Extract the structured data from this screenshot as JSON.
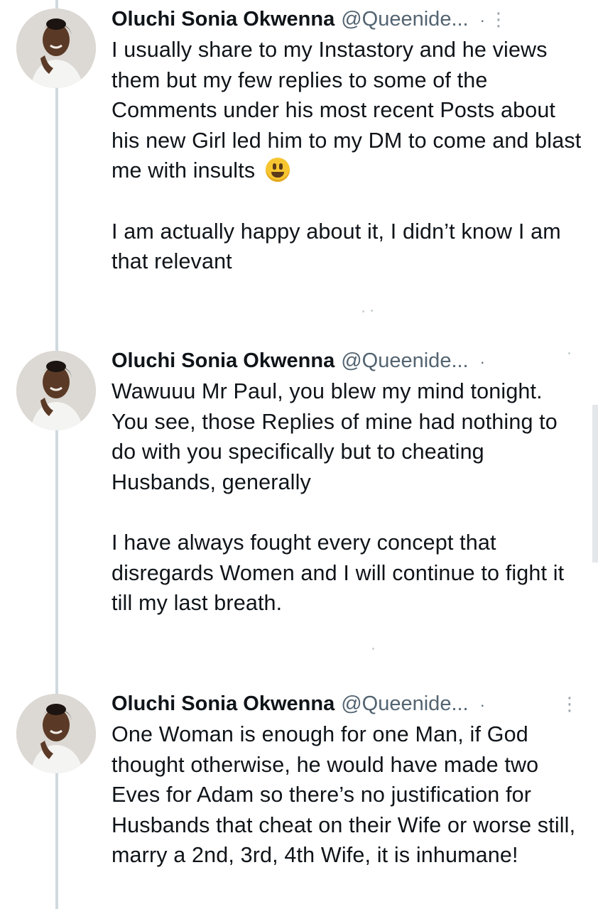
{
  "tweets": [
    {
      "author": "Oluchi Sonia Okwenna",
      "handle": "@Queenide...",
      "separator": "·",
      "more": "⋮",
      "paragraphs": [
        "I usually share to my Instastory and he views them but my few replies to some of the Comments under his most recent Posts about his new Girl led him to my DM to come and blast me with insults",
        "I am actually happy about it, I didn’t know I am that relevant"
      ],
      "emoji": "grinning-face-emoji"
    },
    {
      "author": "Oluchi Sonia Okwenna",
      "handle": "@Queenide...",
      "separator": "·",
      "more": "",
      "paragraphs": [
        "Wawuuu Mr Paul, you blew my mind tonight. You see, those Replies of mine had nothing to do with you specifically but to cheating Husbands, generally",
        "I have always fought every concept that disregards Women and I will continue to fight it till my last breath."
      ]
    },
    {
      "author": "Oluchi Sonia Okwenna",
      "handle": "@Queenide...",
      "separator": "·",
      "more": "⋮",
      "paragraphs": [
        "One Woman is enough for one Man, if God thought otherwise, he would have made two Eves for Adam so there’s no justification for Husbands that cheat on their Wife or worse still, marry a 2nd, 3rd, 4th Wife, it is inhumane!"
      ]
    }
  ],
  "colors": {
    "text": "#0f1419",
    "secondary": "#536471",
    "thread_line": "#cfd9de"
  }
}
